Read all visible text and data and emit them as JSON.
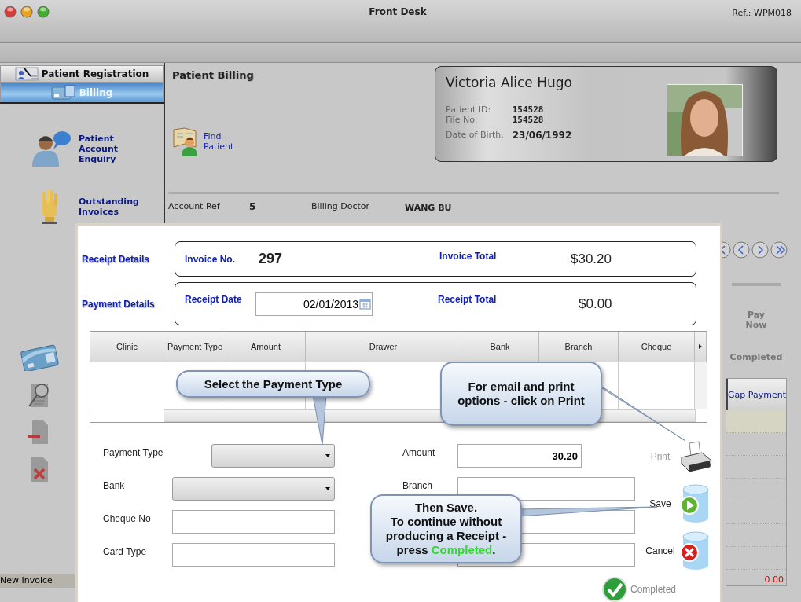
{
  "window": {
    "title": "Front Desk",
    "ref": "Ref.: WPM018"
  },
  "sidebar": {
    "sections": [
      {
        "label": "Patient Registration",
        "selected": false
      },
      {
        "label": "Billing",
        "selected": true
      }
    ],
    "items": [
      {
        "label": "Patient Account Enquiry",
        "kind": "enquiry"
      },
      {
        "label": "Outstanding Invoices",
        "kind": "invoices"
      }
    ]
  },
  "status_bar": {
    "text": "New Invoice"
  },
  "billing": {
    "title": "Patient Billing",
    "find_patient": "Find Patient",
    "account": [
      {
        "label": "Account Ref",
        "value": "5"
      },
      {
        "label": "Billing Doctor",
        "value": "WANG BU"
      }
    ],
    "pay_now": "Pay Now",
    "completed": "Completed",
    "gap_table": {
      "column": "Gap Payment",
      "total": "0.00"
    }
  },
  "patient": {
    "name": "Victoria Alice Hugo",
    "fields": [
      {
        "label": "Patient ID:",
        "value": "154528"
      },
      {
        "label": "File No:",
        "value": "154528"
      },
      {
        "label": "Date of Birth:",
        "value": "23/06/1992"
      }
    ]
  },
  "dialog": {
    "receipt_details": {
      "label": "Receipt Details",
      "invoice_no_label": "Invoice No.",
      "invoice_no": "297",
      "invoice_total_label": "Invoice Total",
      "invoice_total": "$30.20"
    },
    "payment_details": {
      "label": "Payment Details",
      "receipt_date_label": "Receipt Date",
      "receipt_date": "02/01/2013",
      "receipt_total_label": "Receipt Total",
      "receipt_total": "$0.00"
    },
    "table": {
      "columns": [
        "Clinic",
        "Payment Type",
        "Amount",
        "Drawer",
        "Bank",
        "Branch",
        "Cheque"
      ]
    },
    "left_fields": [
      {
        "label": "Payment Type",
        "kind": "dropdown"
      },
      {
        "label": "Bank",
        "kind": "dropdown"
      },
      {
        "label": "Cheque No",
        "kind": "text"
      },
      {
        "label": "Card Type",
        "kind": "text"
      }
    ],
    "right_fields": [
      {
        "label": "Amount",
        "kind": "text",
        "value": "30.20"
      },
      {
        "label": "Branch",
        "kind": "text"
      },
      {
        "kind": "text"
      },
      {
        "kind": "text"
      }
    ],
    "actions": [
      {
        "label": "Print",
        "kind": "print",
        "disabled": true
      },
      {
        "label": "Save",
        "kind": "save",
        "disabled": false
      },
      {
        "label": "Cancel",
        "kind": "cancel",
        "disabled": false
      }
    ],
    "completed": "Completed"
  },
  "callouts": [
    {
      "lines": [
        "Select the Payment Type"
      ]
    },
    {
      "lines": [
        "For email and print options - click on Print"
      ]
    },
    {
      "lines": [
        "Then Save.",
        "To continue without producing a Receipt - press **Completed**."
      ]
    }
  ]
}
